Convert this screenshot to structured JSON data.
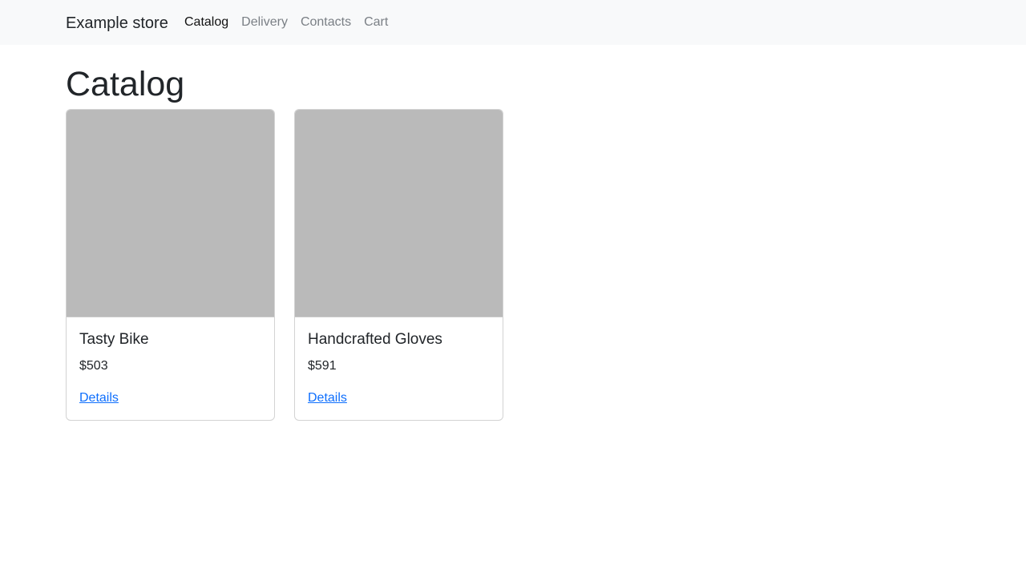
{
  "navbar": {
    "brand": "Example store",
    "links": [
      {
        "label": "Catalog",
        "active": true
      },
      {
        "label": "Delivery",
        "active": false
      },
      {
        "label": "Contacts",
        "active": false
      },
      {
        "label": "Cart",
        "active": false
      }
    ]
  },
  "page": {
    "title": "Catalog"
  },
  "products": [
    {
      "name": "Tasty Bike",
      "price": "$503",
      "link_label": "Details"
    },
    {
      "name": "Handcrafted Gloves",
      "price": "$591",
      "link_label": "Details"
    }
  ],
  "colors": {
    "navbar_bg": "#f8f9fa",
    "link": "#0d6efd",
    "image_placeholder": "#bababa",
    "nav_inactive": "#7a7f85"
  }
}
